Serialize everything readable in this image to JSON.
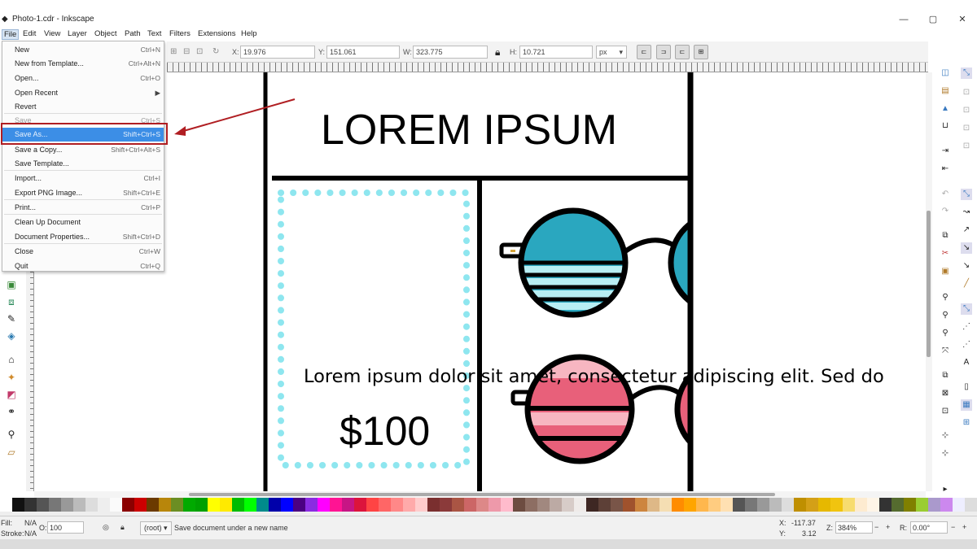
{
  "window": {
    "title": "Photo-1.cdr - Inkscape",
    "minimize": "—",
    "maximize": "▢",
    "close": "✕"
  },
  "menubar": [
    "File",
    "Edit",
    "View",
    "Layer",
    "Object",
    "Path",
    "Text",
    "Filters",
    "Extensions",
    "Help"
  ],
  "file_menu": [
    {
      "label": "New",
      "shortcut": "Ctrl+N"
    },
    {
      "label": "New from Template...",
      "shortcut": "Ctrl+Alt+N"
    },
    {
      "label": "Open...",
      "shortcut": "Ctrl+O"
    },
    {
      "label": "Open Recent",
      "shortcut": "▶"
    },
    {
      "label": "Revert",
      "shortcut": ""
    },
    {
      "label": "Save",
      "shortcut": "Ctrl+S"
    },
    {
      "label": "Save As...",
      "shortcut": "Shift+Ctrl+S"
    },
    {
      "label": "Save a Copy...",
      "shortcut": "Shift+Ctrl+Alt+S"
    },
    {
      "label": "Save Template...",
      "shortcut": ""
    },
    {
      "label": "Import...",
      "shortcut": "Ctrl+I"
    },
    {
      "label": "Export PNG Image...",
      "shortcut": "Shift+Ctrl+E"
    },
    {
      "label": "Print...",
      "shortcut": "Ctrl+P"
    },
    {
      "label": "Clean Up Document",
      "shortcut": ""
    },
    {
      "label": "Document Properties...",
      "shortcut": "Shift+Ctrl+D"
    },
    {
      "label": "Close",
      "shortcut": "Ctrl+W"
    },
    {
      "label": "Quit",
      "shortcut": "Ctrl+Q"
    }
  ],
  "toolbar": {
    "x_label": "X:",
    "x": "19.976",
    "y_label": "Y:",
    "y": "151.061",
    "w_label": "W:",
    "w": "323.775",
    "h_label": "H:",
    "h": "10.721",
    "unit": "px"
  },
  "document": {
    "heading": "LOREM IPSUM",
    "body": "Lorem ipsum dolor sit amet, consectetur adipiscing elit. Sed do",
    "price": "$100"
  },
  "status": {
    "fill_label": "Fill:",
    "fill": "N/A",
    "stroke_label": "Stroke:",
    "stroke": "N/A",
    "opacity_label": "O:",
    "opacity": "100",
    "layer": "(root)",
    "message": "Save document under a new name",
    "x_label": "X:",
    "x": "-117.37",
    "y_label": "Y:",
    "y": "3.12",
    "zoom_label": "Z:",
    "zoom": "384%",
    "rotate_label": "R:",
    "rotate": "0.00°"
  },
  "colors": {
    "accent": "#3c8ee6",
    "highlight_box": "#b01e22",
    "arrow": "#b01e22",
    "dots": "#8ee6ef",
    "lens_blue": "#2aa7bf",
    "lens_pink": "#e8607a"
  }
}
